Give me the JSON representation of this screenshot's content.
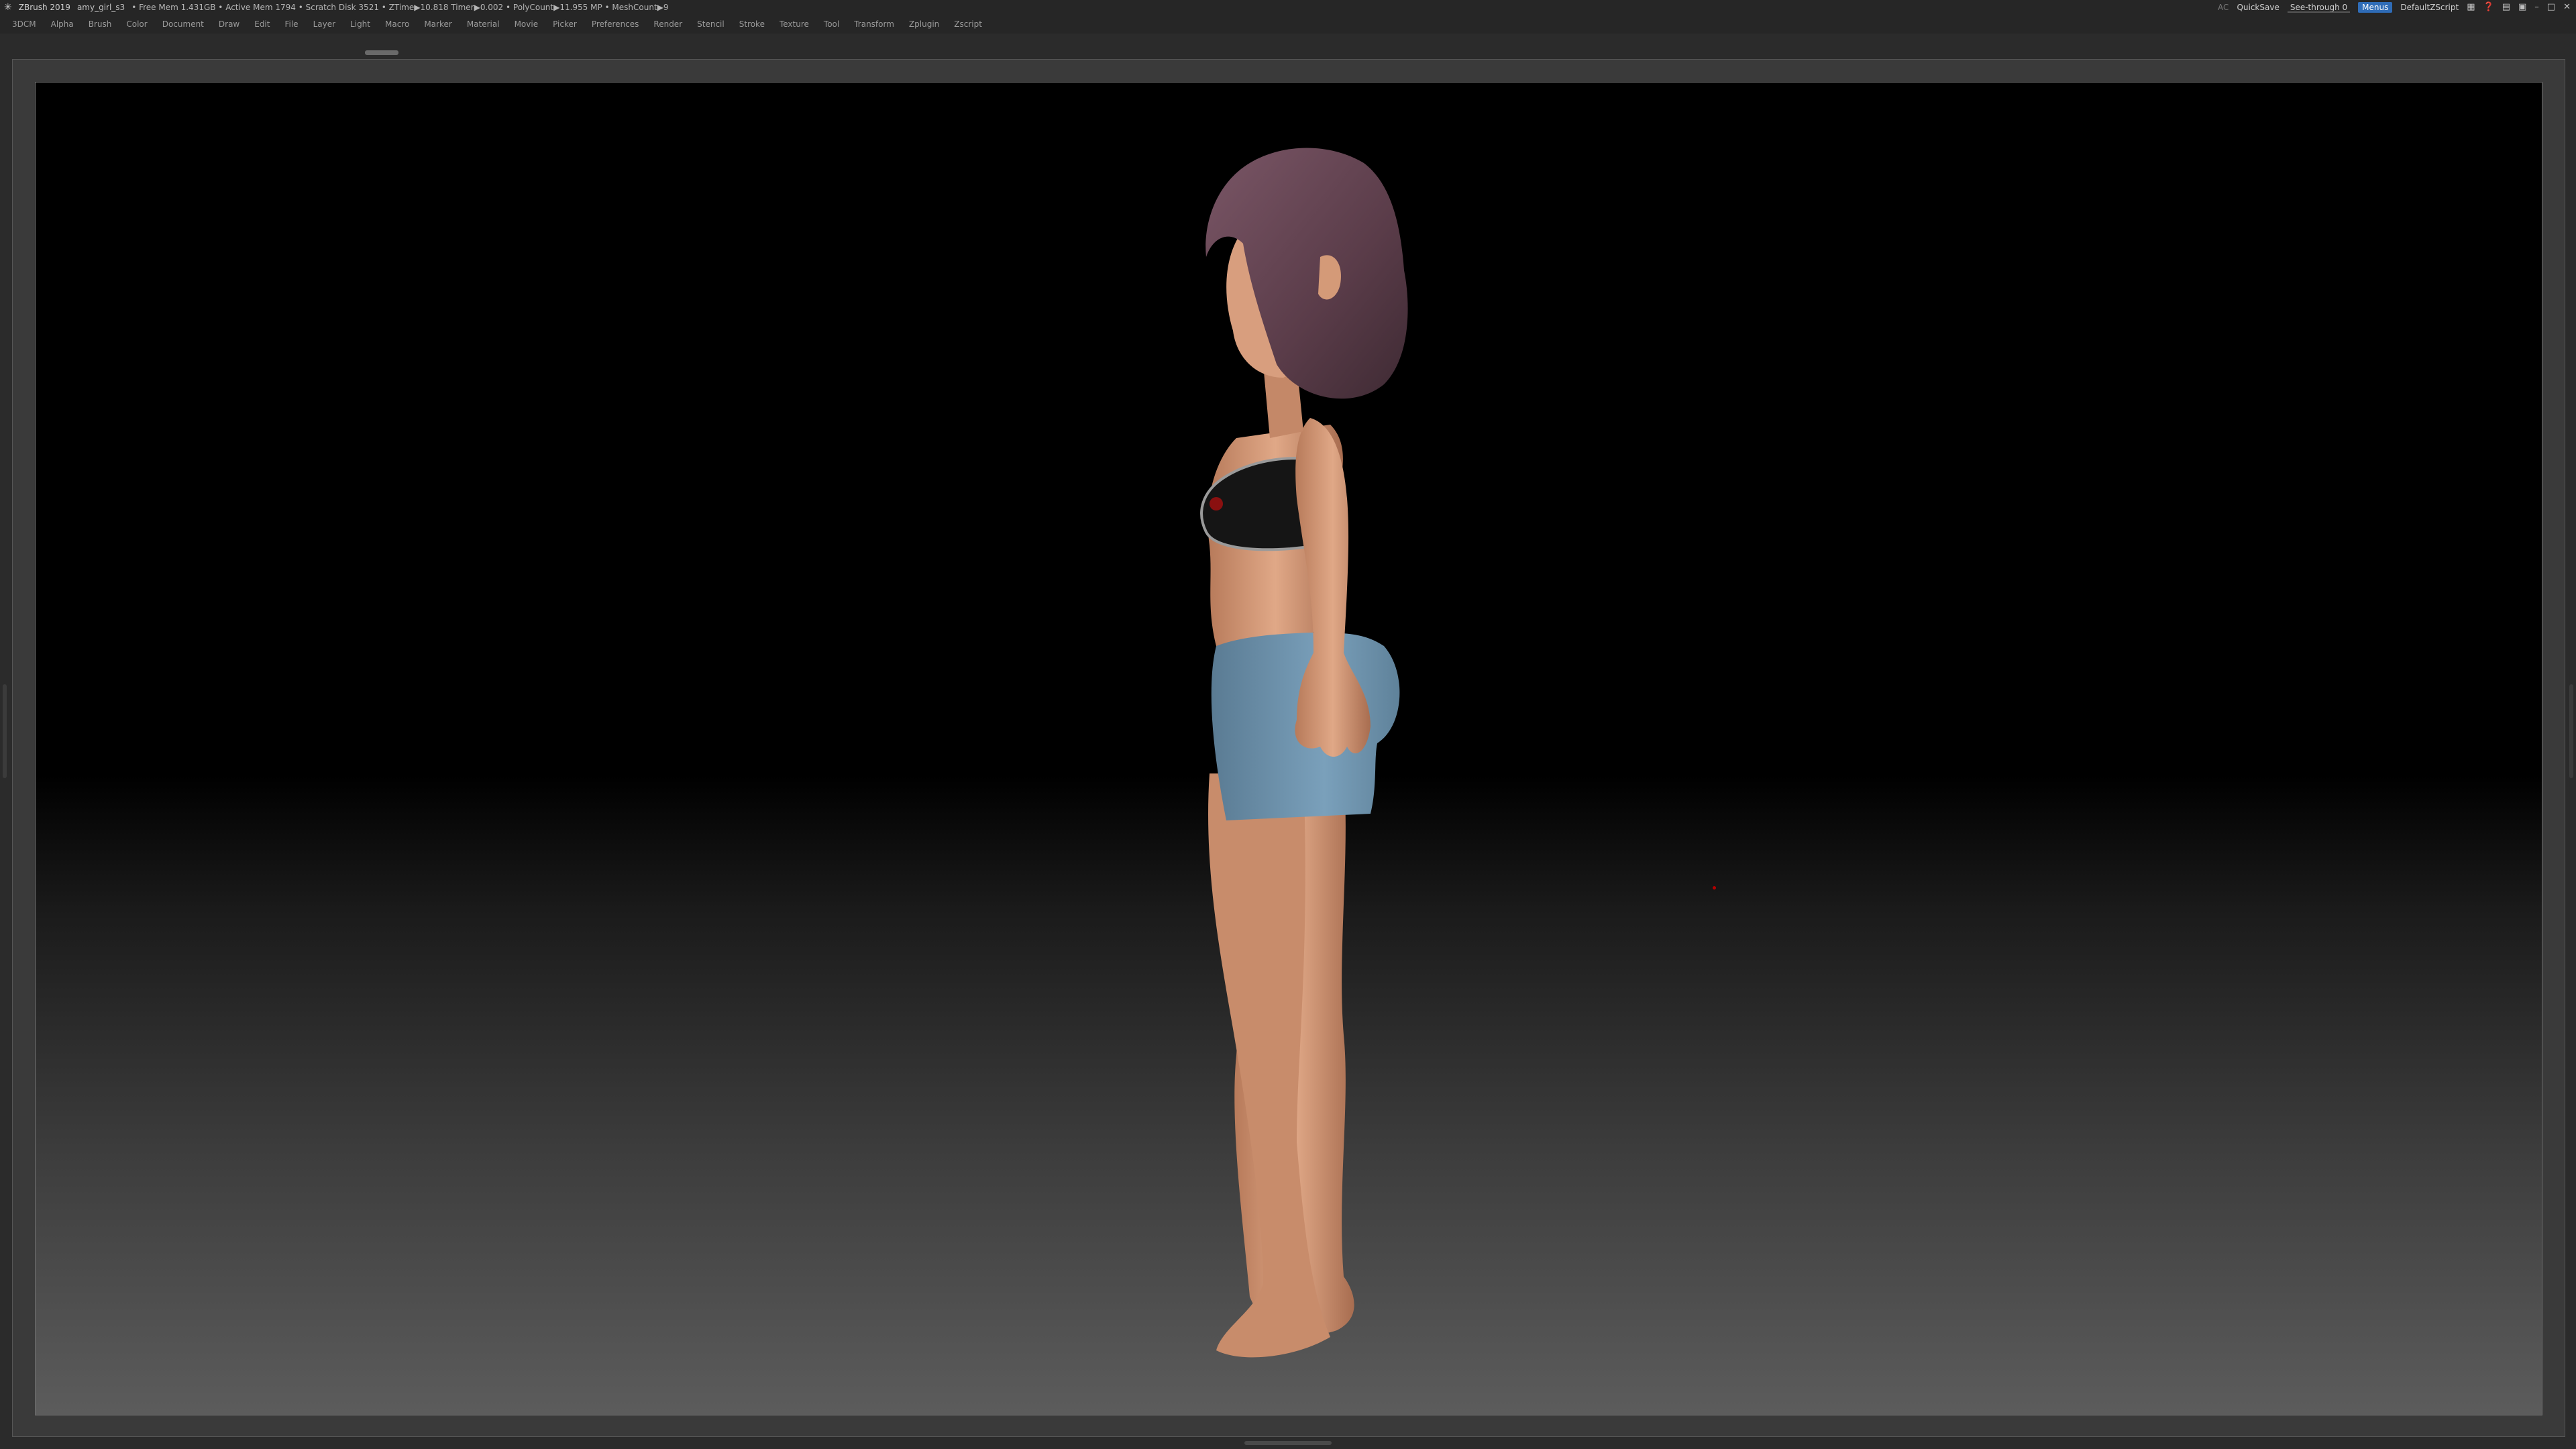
{
  "titlebar": {
    "app_title": "ZBrush 2019",
    "file_name": "amy_girl_s3",
    "stats": "• Free Mem 1.431GB • Active Mem 1794 • Scratch Disk 3521 • ZTime▶10.818 Timer▶0.002 • PolyCount▶11.955 MP • MeshCount▶9",
    "ac_label": "AC",
    "quicksave_label": "QuickSave",
    "see_through_label": "See-through  0",
    "see_through_value": 0,
    "menus_label": "Menus",
    "script_label": "DefaultZScript"
  },
  "menubar": {
    "items": [
      "3DCM",
      "Alpha",
      "Brush",
      "Color",
      "Document",
      "Draw",
      "Edit",
      "File",
      "Layer",
      "Light",
      "Macro",
      "Marker",
      "Material",
      "Movie",
      "Picker",
      "Preferences",
      "Render",
      "Stencil",
      "Stroke",
      "Texture",
      "Tool",
      "Transform",
      "Zplugin",
      "Zscript"
    ]
  },
  "colors": {
    "ui_background": "#262626",
    "menus_button": "#2f6cb7",
    "see_through_accent": "#e8a03a",
    "hair": "#5e3f4c",
    "skin": "#d49a78",
    "top": "#1a1a1a",
    "shorts": "#6e93ad"
  },
  "icons": {
    "logo": "zbrush-logo-icon",
    "window_controls": [
      "layout-icon",
      "help-icon",
      "grid-icon",
      "lock-icon",
      "minimize-icon",
      "maximize-icon",
      "close-icon"
    ]
  }
}
